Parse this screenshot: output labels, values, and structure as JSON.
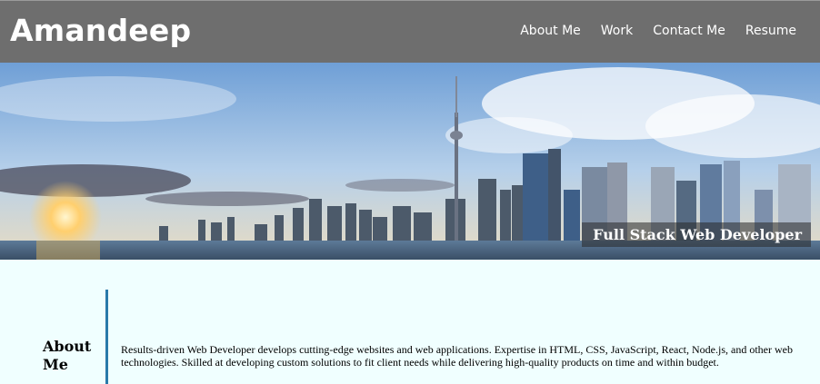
{
  "header": {
    "brand": "Amandeep",
    "nav": [
      "About Me",
      "Work",
      "Contact Me",
      "Resume"
    ]
  },
  "hero": {
    "tagline": "Full Stack Web Developer"
  },
  "about": {
    "heading": "About Me",
    "text": "Results-driven Web Developer develops cutting-edge websites and web applications. Expertise in HTML, CSS, JavaScript, React, Node.js, and other web technologies. Skilled at developing custom solutions to fit client needs while delivering high-quality products on time and within budget."
  },
  "colors": {
    "navbar": "#6e6e6e",
    "page_background": "#f0ffff",
    "divider": "#2a7aaa"
  }
}
